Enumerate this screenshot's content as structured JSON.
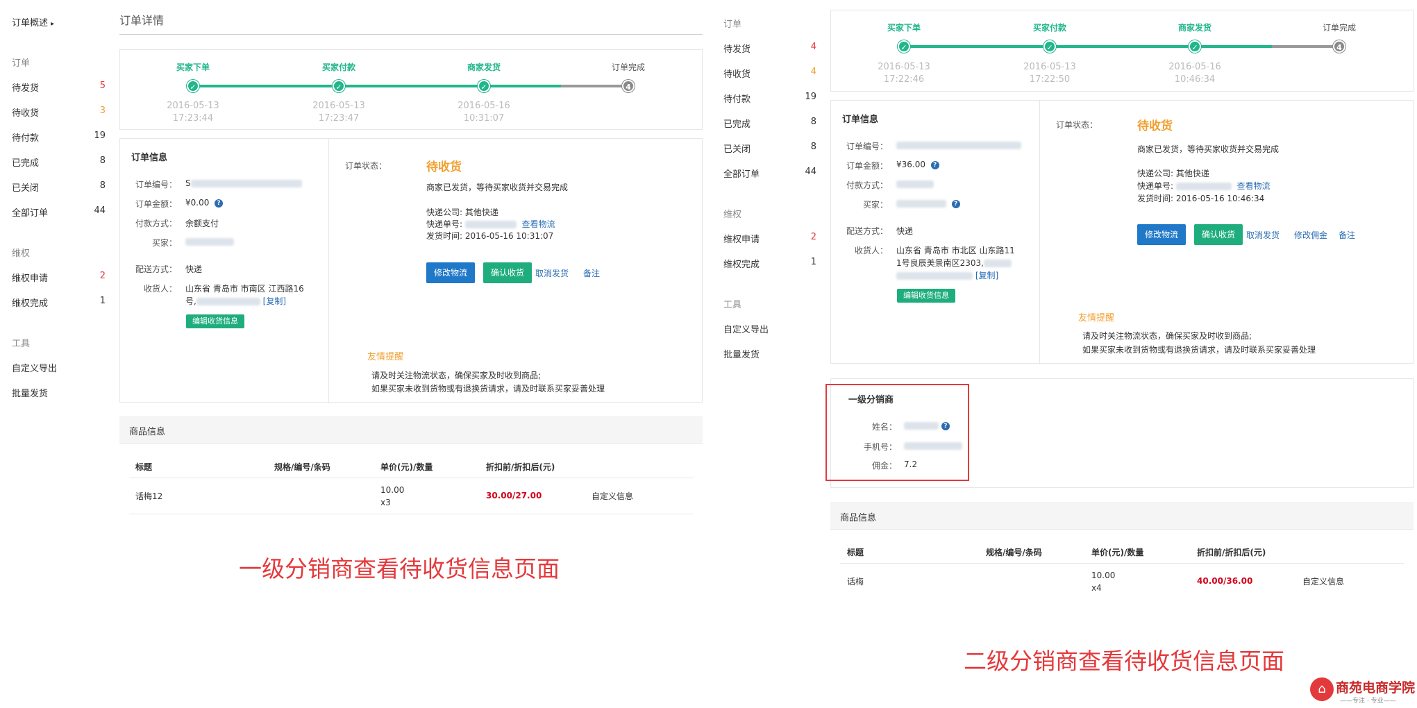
{
  "left": {
    "sidebar": {
      "overview": "订单概述",
      "order_section": "订单",
      "orders": [
        {
          "label": "待发货",
          "count": "5",
          "color": "red"
        },
        {
          "label": "待收货",
          "count": "3",
          "color": "orange"
        },
        {
          "label": "待付款",
          "count": "19",
          "color": "dark"
        },
        {
          "label": "已完成",
          "count": "8",
          "color": "dark"
        },
        {
          "label": "已关闭",
          "count": "8",
          "color": "dark"
        },
        {
          "label": "全部订单",
          "count": "44",
          "color": "dark"
        }
      ],
      "rights_section": "维权",
      "rights": [
        {
          "label": "维权申请",
          "count": "2",
          "color": "red"
        },
        {
          "label": "维权完成",
          "count": "1",
          "color": "dark"
        }
      ],
      "tools_section": "工具",
      "tools": [
        "自定义导出",
        "批量发货"
      ]
    },
    "page_title": "订单详情",
    "steps": [
      {
        "label": "买家下单",
        "date": "2016-05-13",
        "time": "17:23:44"
      },
      {
        "label": "买家付款",
        "date": "2016-05-13",
        "time": "17:23:47"
      },
      {
        "label": "商家发货",
        "date": "2016-05-16",
        "time": "10:31:07"
      },
      {
        "label": "订单完成",
        "number": "4"
      }
    ],
    "order_info": {
      "title": "订单信息",
      "order_no_label": "订单编号：",
      "order_no_prefix": "S",
      "amount_label": "订单金额：",
      "amount": "¥0.00",
      "pay_label": "付款方式：",
      "pay": "余额支付",
      "buyer_label": "买家：",
      "ship_label": "配送方式：",
      "ship": "快递",
      "receiver_label": "收货人：",
      "receiver_line1": "山东省 青岛市 市南区 江西路16",
      "receiver_line2": "号,",
      "copy": "[复制]",
      "edit_btn": "编辑收货信息"
    },
    "status": {
      "label": "订单状态：",
      "value": "待收货",
      "desc": "商家已发货，等待买家收货并交易完成",
      "express_company": "快递公司: 其他快递",
      "express_no_label": "快递单号:",
      "view_logistics": "查看物流",
      "ship_time": "发货时间: 2016-05-16 10:31:07",
      "btn_modify": "修改物流",
      "btn_confirm": "确认收货",
      "cancel": "取消发货",
      "note": "备注",
      "tip_title": "友情提醒",
      "tip1": "请及时关注物流状态，确保买家及时收到商品;",
      "tip2": "如果买家未收到货物或有退换货请求，请及时联系买家妥善处理"
    },
    "goods": {
      "title": "商品信息",
      "headers": [
        "标题",
        "规格/编号/条码",
        "单价(元)/数量",
        "折扣前/折扣后(元)"
      ],
      "row": {
        "name": "话梅12",
        "unit": "10.00",
        "qty": "x3",
        "price": "30.00/27.00",
        "custom": "自定义信息"
      }
    },
    "caption": "一级分销商查看待收货信息页面"
  },
  "right": {
    "sidebar": {
      "order_section": "订单",
      "orders": [
        {
          "label": "待发货",
          "count": "4",
          "color": "red"
        },
        {
          "label": "待收货",
          "count": "4",
          "color": "orange"
        },
        {
          "label": "待付款",
          "count": "19",
          "color": "dark"
        },
        {
          "label": "已完成",
          "count": "8",
          "color": "dark"
        },
        {
          "label": "已关闭",
          "count": "8",
          "color": "dark"
        },
        {
          "label": "全部订单",
          "count": "44",
          "color": "dark"
        }
      ],
      "rights_section": "维权",
      "rights": [
        {
          "label": "维权申请",
          "count": "2",
          "color": "red"
        },
        {
          "label": "维权完成",
          "count": "1",
          "color": "dark"
        }
      ],
      "tools_section": "工具",
      "tools": [
        "自定义导出",
        "批量发货"
      ]
    },
    "steps": [
      {
        "label": "买家下单",
        "date": "2016-05-13",
        "time": "17:22:46"
      },
      {
        "label": "买家付款",
        "date": "2016-05-13",
        "time": "17:22:50"
      },
      {
        "label": "商家发货",
        "date": "2016-05-16",
        "time": "10:46:34"
      },
      {
        "label": "订单完成",
        "number": "4"
      }
    ],
    "order_info": {
      "title": "订单信息",
      "order_no_label": "订单编号：",
      "amount_label": "订单金额：",
      "amount": "¥36.00",
      "pay_label": "付款方式：",
      "buyer_label": "买家：",
      "ship_label": "配送方式：",
      "ship": "快递",
      "receiver_label": "收货人：",
      "receiver_line1": "山东省 青岛市 市北区 山东路11",
      "receiver_line2": "1号良辰美景南区2303,",
      "copy": "[复制]",
      "edit_btn": "编辑收货信息"
    },
    "status": {
      "label": "订单状态：",
      "value": "待收货",
      "desc": "商家已发货，等待买家收货并交易完成",
      "express_company": "快递公司: 其他快递",
      "express_no_label": "快递单号:",
      "view_logistics": "查看物流",
      "ship_time": "发货时间: 2016-05-16 10:46:34",
      "btn_modify": "修改物流",
      "btn_confirm": "确认收货",
      "cancel": "取消发货",
      "commission": "修改佣金",
      "note": "备注",
      "tip_title": "友情提醒",
      "tip1": "请及时关注物流状态，确保买家及时收到商品;",
      "tip2": "如果买家未收到货物或有退换货请求，请及时联系买家妥善处理"
    },
    "distributor": {
      "title": "一级分销商",
      "name_label": "姓名：",
      "phone_label": "手机号：",
      "commission_label": "佣金：",
      "commission": "7.2"
    },
    "goods": {
      "title": "商品信息",
      "headers": [
        "标题",
        "规格/编号/条码",
        "单价(元)/数量",
        "折扣前/折扣后(元)"
      ],
      "row": {
        "name": "话梅",
        "unit": "10.00",
        "qty": "x4",
        "price": "40.00/36.00",
        "custom": "自定义信息"
      }
    },
    "caption": "二级分销商查看待收货信息页面"
  },
  "logo": {
    "name": "商苑电商学院",
    "slogan": "——专注 · 专业——"
  },
  "colors": {
    "green": "#21b68b",
    "blue": "#1f78c8",
    "orange": "#f0a030",
    "red": "#e4393c",
    "price_red": "#d0021b"
  }
}
